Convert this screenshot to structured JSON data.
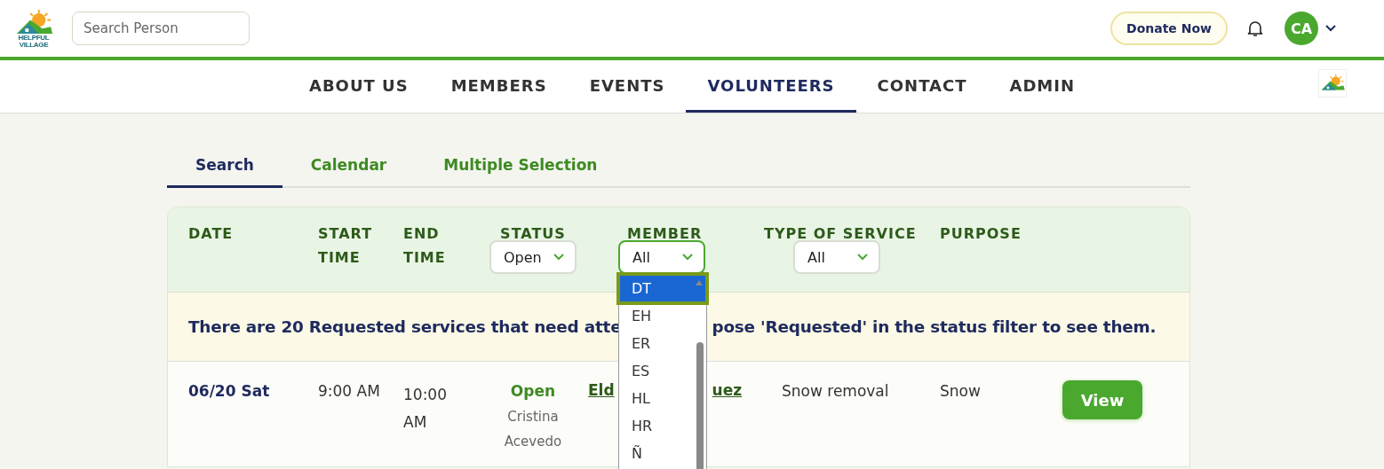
{
  "header": {
    "logo_lines": [
      "HELPFUL",
      "VILLAGE"
    ],
    "search": {
      "placeholder": "Search Person"
    },
    "donate_button": "Donate Now",
    "avatar": {
      "initials": "CA"
    }
  },
  "nav": [
    {
      "label": "ABOUT US",
      "selected": false
    },
    {
      "label": "MEMBERS",
      "selected": false
    },
    {
      "label": "EVENTS",
      "selected": false
    },
    {
      "label": "VOLUNTEERS",
      "selected": true
    },
    {
      "label": "CONTACT",
      "selected": false
    },
    {
      "label": "ADMIN",
      "selected": false
    }
  ],
  "tabs": [
    {
      "label": "Search",
      "selected": true
    },
    {
      "label": "Calendar",
      "selected": false
    },
    {
      "label": "Multiple Selection",
      "selected": false
    }
  ],
  "filters": {
    "columns": [
      {
        "label": "DATE"
      },
      {
        "label": "START TIME"
      },
      {
        "label": "END TIME"
      },
      {
        "label": "STATUS",
        "select": {
          "value": "Open"
        }
      },
      {
        "label": "MEMBER",
        "select": {
          "value": "All",
          "open": true,
          "options": [
            {
              "label": "DT",
              "selected": true
            },
            {
              "label": "EH",
              "selected": false
            },
            {
              "label": "ER",
              "selected": false
            },
            {
              "label": "ES",
              "selected": false
            },
            {
              "label": "HL",
              "selected": false
            },
            {
              "label": "HR",
              "selected": false
            },
            {
              "label": "Ñ",
              "selected": false
            }
          ]
        }
      },
      {
        "label": "TYPE OF SERVICE",
        "select": {
          "value": "All"
        }
      },
      {
        "label": "PURPOSE"
      }
    ]
  },
  "banner": {
    "before": "There are 20 Requested services that need atte",
    "after": "pose 'Requested' in the status filter to see them."
  },
  "rows": [
    {
      "date": "06/20 Sat",
      "start_time": "9:00 AM",
      "end_time": "10:00 AM",
      "status": "Open",
      "volunteer": "Cristina Acevedo",
      "member_before": "Eld",
      "member_after": "uez",
      "type": "Snow removal",
      "purpose": "Snow",
      "action": "View"
    }
  ]
}
